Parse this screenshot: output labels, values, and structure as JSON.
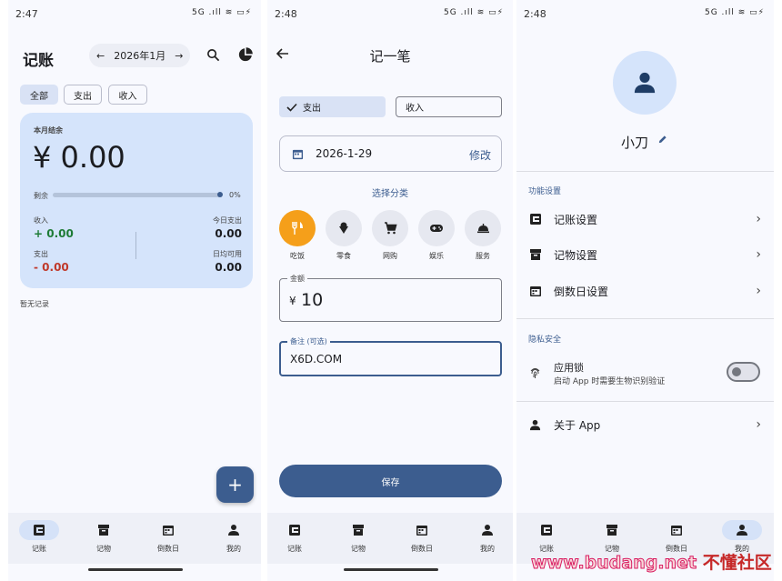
{
  "screen1": {
    "time": "2:47",
    "status_icons": "5G .ıll ≋ ▭⚡",
    "title": "记账",
    "month": "2026年1月",
    "prev_arrow": "←",
    "next_arrow": "→",
    "filters": [
      "全部",
      "支出",
      "收入"
    ],
    "summary": {
      "label": "本月结余",
      "balance": "¥ 0.00",
      "remaining_label": "剩余",
      "remaining_percent": "0%",
      "remaining_fraction": 0,
      "income_label": "收入",
      "income_value": "+ 0.00",
      "today_expense_label": "今日支出",
      "today_expense_value": "0.00",
      "expense_label": "支出",
      "expense_value": "- 0.00",
      "daily_available_label": "日均可用",
      "daily_available_value": "0.00"
    },
    "empty_text": "暂无记录",
    "fab_label": "+"
  },
  "screen2": {
    "time": "2:48",
    "status_icons": "5G .ıll ≋ ▭⚡",
    "title": "记一笔",
    "type_expense": "支出",
    "type_income": "收入",
    "date": "2026-1-29",
    "date_edit": "修改",
    "category_title": "选择分类",
    "categories": [
      {
        "label": "吃饭",
        "icon": "utensils-icon",
        "selected": true
      },
      {
        "label": "零食",
        "icon": "icecream-icon",
        "selected": false
      },
      {
        "label": "网购",
        "icon": "cart-icon",
        "selected": false
      },
      {
        "label": "娱乐",
        "icon": "gamepad-icon",
        "selected": false
      },
      {
        "label": "服务",
        "icon": "service-bell-icon",
        "selected": false
      }
    ],
    "amount_label": "金额",
    "amount_currency": "¥",
    "amount_value": "10",
    "note_label": "备注 (可选)",
    "note_value": "X6D.COM",
    "save_label": "保存"
  },
  "screen3": {
    "time": "2:48",
    "status_icons": "5G .ıll ≋ ▭⚡",
    "username": "小刀",
    "section_features": "功能设置",
    "items": [
      {
        "label": "记账设置",
        "icon": "ledger-icon"
      },
      {
        "label": "记物设置",
        "icon": "box-icon"
      },
      {
        "label": "倒数日设置",
        "icon": "calendar-icon"
      }
    ],
    "section_privacy": "隐私安全",
    "app_lock_label": "应用锁",
    "app_lock_desc": "启动 App 时需要生物识别验证",
    "app_lock_on": false,
    "about_label": "关于 App"
  },
  "nav": [
    "记账",
    "记物",
    "倒数日",
    "我的"
  ],
  "watermark": {
    "url": "www.budang.net",
    "cn": "不懂社区"
  },
  "colors": {
    "primary": "#3c5d8f",
    "card": "#d5e4fb",
    "income": "#1e7b36",
    "expense": "#c0392b",
    "selected_category": "#f59f1a"
  }
}
